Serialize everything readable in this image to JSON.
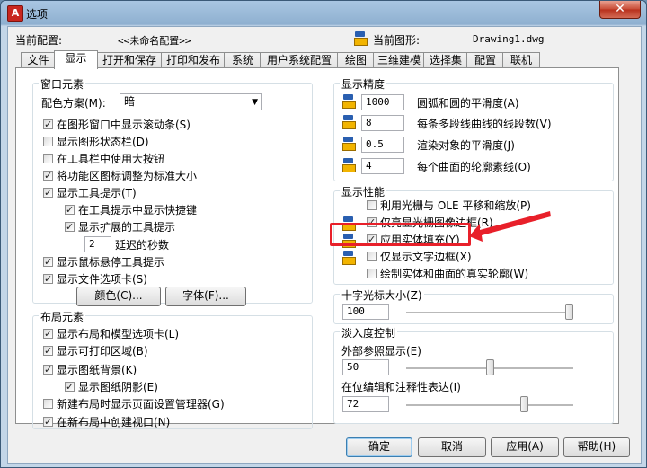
{
  "window": {
    "title": "选项",
    "close_glyph": "✕"
  },
  "header": {
    "current_profile_label": "当前配置:",
    "current_profile_value": "<<未命名配置>>",
    "current_drawing_label": "当前图形:",
    "current_drawing_value": "Drawing1.dwg"
  },
  "tabs": [
    "文件",
    "显示",
    "打开和保存",
    "打印和发布",
    "系统",
    "用户系统配置",
    "绘图",
    "三维建模",
    "选择集",
    "配置",
    "联机"
  ],
  "window_elements": {
    "title": "窗口元素",
    "color_scheme_label": "配色方案(M):",
    "color_scheme_value": "暗",
    "options": [
      "在图形窗口中显示滚动条(S)",
      "显示图形状态栏(D)",
      "在工具栏中使用大按钮",
      "将功能区图标调整为标准大小",
      "显示工具提示(T)",
      "在工具提示中显示快捷键",
      "显示扩展的工具提示",
      "显示鼠标悬停工具提示",
      "显示文件选项卡(S)"
    ],
    "delay_value": "2",
    "delay_label": "延迟的秒数",
    "colors_button": "颜色(C)...",
    "fonts_button": "字体(F)..."
  },
  "layout_elements": {
    "title": "布局元素",
    "options": [
      "显示布局和模型选项卡(L)",
      "显示可打印区域(B)",
      "显示图纸背景(K)",
      "显示图纸阴影(E)",
      "新建布局时显示页面设置管理器(G)",
      "在新布局中创建视口(N)"
    ]
  },
  "display_resolution": {
    "title": "显示精度",
    "rows": [
      {
        "value": "1000",
        "label": "圆弧和圆的平滑度(A)"
      },
      {
        "value": "8",
        "label": "每条多段线曲线的线段数(V)"
      },
      {
        "value": "0.5",
        "label": "渲染对象的平滑度(J)"
      },
      {
        "value": "4",
        "label": "每个曲面的轮廓素线(O)"
      }
    ]
  },
  "display_performance": {
    "title": "显示性能",
    "options": [
      "利用光栅与 OLE 平移和缩放(P)",
      "仅亮显光栅图像边框(R)",
      "应用实体填充(Y)",
      "仅显示文字边框(X)",
      "绘制实体和曲面的真实轮廓(W)"
    ]
  },
  "crosshair": {
    "title": "十字光标大小(Z)",
    "value": "100",
    "level_percent": 100
  },
  "fade": {
    "title": "淡入度控制",
    "xref_label": "外部参照显示(E)",
    "xref_value": "50",
    "xref_level_percent": 50,
    "inplace_label": "在位编辑和注释性表达(I)",
    "inplace_value": "72",
    "inplace_level_percent": 72
  },
  "buttons": {
    "ok": "确定",
    "cancel": "取消",
    "apply": "应用(A)",
    "help": "帮助(H)"
  },
  "colors": {
    "annotation_red": "#e8202a",
    "accent_blue": "#3c7fb1"
  }
}
